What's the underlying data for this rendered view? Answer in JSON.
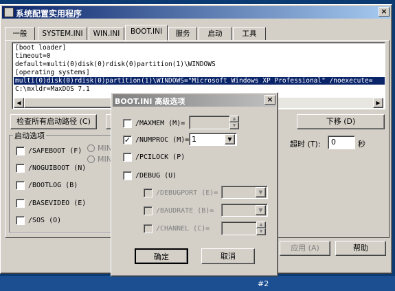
{
  "window": {
    "title": "系统配置实用程序",
    "close_label": "×",
    "tabs": [
      "一般",
      "SYSTEM.INI",
      "WIN.INI",
      "BOOT.INI",
      "服务",
      "启动",
      "工具"
    ],
    "boot_lines": [
      "[boot loader]",
      "timeout=0",
      "default=multi(0)disk(0)rdisk(0)partition(1)\\WINDOWS",
      "[operating systems]",
      "multi(0)disk(0)rdisk(0)partition(1)\\WINDOWS=\"Microsoft Windows XP Professional\" /noexecute=",
      "C:\\mxldr=MaxDOS 7.1"
    ],
    "check_paths_button": "检查所有启动路径 (C)",
    "move_down_button": "下移 (D)",
    "boot_options_group": "启动选项",
    "boot_options": [
      "/SAFEBOOT (F)",
      "/NOGUIBOOT (N)",
      "/BOOTLOG (B)",
      "/BASEVIDEO (E)",
      "/SOS (O)"
    ],
    "radio_labels": [
      "MIN",
      "MIN"
    ],
    "timeout_label": "超时 (T):",
    "timeout_value": "0",
    "timeout_unit": "秒",
    "apply_button": "应用 (A)",
    "help_button": "帮助",
    "taskbar_label": "#2"
  },
  "dialog": {
    "title": "BOOT.INI 高级选项",
    "close_label": "×",
    "maxmem_label": "/MAXMEM (M)=",
    "maxmem_checked": false,
    "numproc_label": "/NUMPROC (M)=",
    "numproc_checked": true,
    "numproc_value": "1",
    "pcilock_label": "/PCILOCK (P)",
    "debug_label": "/DEBUG (U)",
    "debugport_label": "/DEBUGPORT (E)=",
    "baudrate_label": "/BAUDRATE (B)=",
    "channel_label": "/CHANNEL (C)=",
    "ok_button": "确定",
    "cancel_button": "取消"
  }
}
